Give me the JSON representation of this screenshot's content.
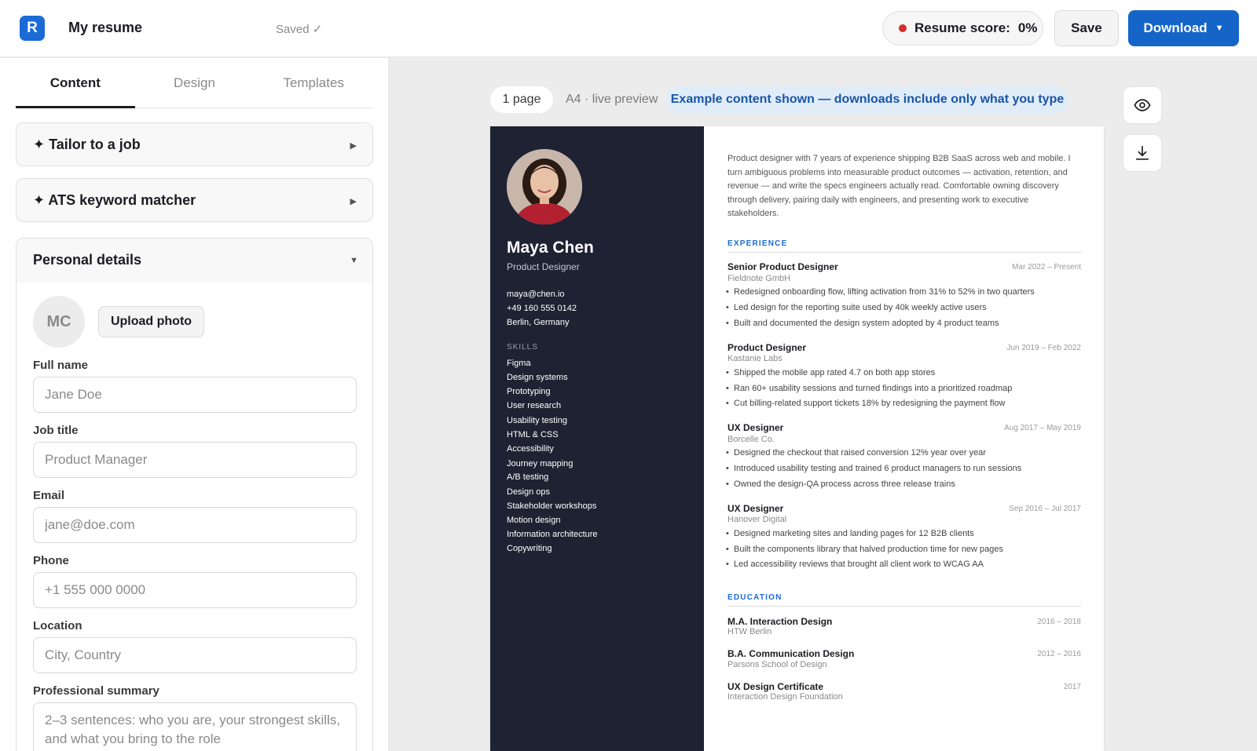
{
  "header": {
    "logo_letter": "R",
    "title": "My resume",
    "saved_status": "Saved ✓",
    "score_label": "Resume score:",
    "score_value": "0%",
    "score_color": "#d32f2f",
    "save_label": "Save",
    "download_label": "Download",
    "accent": "#1565c9"
  },
  "tabs": [
    {
      "label": "Content",
      "active": true
    },
    {
      "label": "Design",
      "active": false
    },
    {
      "label": "Templates",
      "active": false
    }
  ],
  "accordions": {
    "tailor": "✦ Tailor to a job",
    "ats": "✦ ATS keyword matcher",
    "personal": "Personal details"
  },
  "personal": {
    "avatar_initials": "MC",
    "upload_label": "Upload photo",
    "fields": {
      "full_name": {
        "label": "Full name",
        "placeholder": "Jane Doe"
      },
      "job_title": {
        "label": "Job title",
        "placeholder": "Product Manager"
      },
      "email": {
        "label": "Email",
        "placeholder": "jane@doe.com"
      },
      "phone": {
        "label": "Phone",
        "placeholder": "+1 555 000 0000"
      },
      "location": {
        "label": "Location",
        "placeholder": "City, Country"
      },
      "summary": {
        "label": "Professional summary",
        "placeholder": "2–3 sentences: who you are, your strongest skills, and what you bring to the role"
      }
    }
  },
  "preview": {
    "page_count": "1 page",
    "format_label": "A4 · live preview",
    "notice": "Example content shown — downloads include only what you type"
  },
  "resume": {
    "name": "Maya Chen",
    "role": "Product Designer",
    "contact": [
      "maya@chen.io",
      "+49 160 555 0142",
      "Berlin, Germany"
    ],
    "skills_heading": "SKILLS",
    "skills": [
      "Figma",
      "Design systems",
      "Prototyping",
      "User research",
      "Usability testing",
      "HTML & CSS",
      "Accessibility",
      "Journey mapping",
      "A/B testing",
      "Design ops",
      "Stakeholder workshops",
      "Motion design",
      "Information architecture",
      "Copywriting"
    ],
    "summary": "Product designer with 7 years of experience shipping B2B SaaS across web and mobile. I turn ambiguous problems into measurable product outcomes — activation, retention, and revenue — and write the specs engineers actually read. Comfortable owning discovery through delivery, pairing daily with engineers, and presenting work to executive stakeholders.",
    "experience_heading": "EXPERIENCE",
    "experience": [
      {
        "title": "Senior Product Designer",
        "date": "Mar 2022 – Present",
        "company": "Fieldnote GmbH",
        "bullets": [
          "Redesigned onboarding flow, lifting activation from 31% to 52% in two quarters",
          "Led design for the reporting suite used by 40k weekly active users",
          "Built and documented the design system adopted by 4 product teams"
        ]
      },
      {
        "title": "Product Designer",
        "date": "Jun 2019 – Feb 2022",
        "company": "Kastanie Labs",
        "bullets": [
          "Shipped the mobile app rated 4.7 on both app stores",
          "Ran 60+ usability sessions and turned findings into a prioritized roadmap",
          "Cut billing-related support tickets 18% by redesigning the payment flow"
        ]
      },
      {
        "title": "UX Designer",
        "date": "Aug 2017 – May 2019",
        "company": "Borcelle Co.",
        "bullets": [
          "Designed the checkout that raised conversion 12% year over year",
          "Introduced usability testing and trained 6 product managers to run sessions",
          "Owned the design-QA process across three release trains"
        ]
      },
      {
        "title": "UX Designer",
        "date": "Sep 2016 – Jul 2017",
        "company": "Hanover Digital",
        "bullets": [
          "Designed marketing sites and landing pages for 12 B2B clients",
          "Built the components library that halved production time for new pages",
          "Led accessibility reviews that brought all client work to WCAG AA"
        ]
      }
    ],
    "education_heading": "EDUCATION",
    "education": [
      {
        "title": "M.A. Interaction Design",
        "date": "2016 – 2018",
        "school": "HTW Berlin"
      },
      {
        "title": "B.A. Communication Design",
        "date": "2012 – 2016",
        "school": "Parsons School of Design"
      },
      {
        "title": "UX Design Certificate",
        "date": "2017",
        "school": "Interaction Design Foundation"
      }
    ]
  }
}
